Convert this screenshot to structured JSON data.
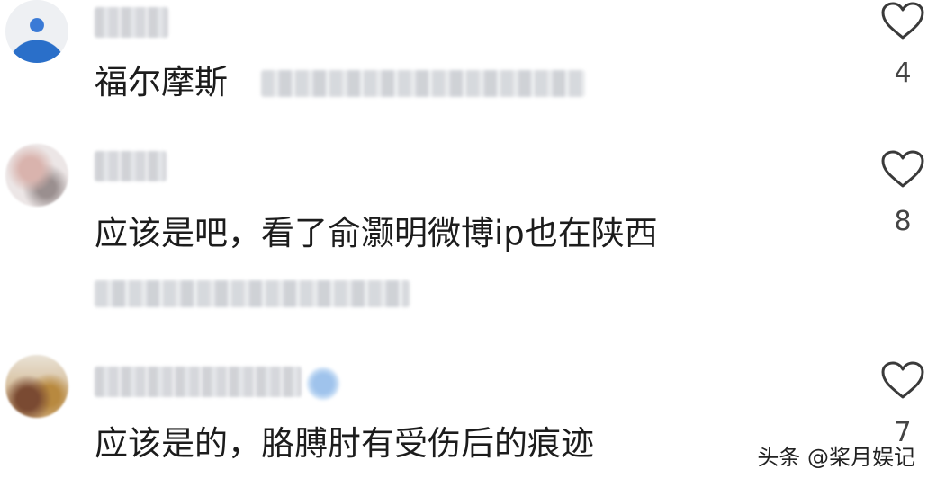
{
  "comments": [
    {
      "text": "福尔摩斯",
      "likes": "4"
    },
    {
      "text": "应该是吧，看了俞灏明微博ip也在陕西",
      "likes": "8"
    },
    {
      "text": "应该是的，胳膊肘有受伤后的痕迹",
      "likes": "7"
    }
  ],
  "watermark": "头条 @桨月娱记",
  "icons": {
    "like": "heart-outline-icon",
    "verified": "verified-badge-icon"
  }
}
